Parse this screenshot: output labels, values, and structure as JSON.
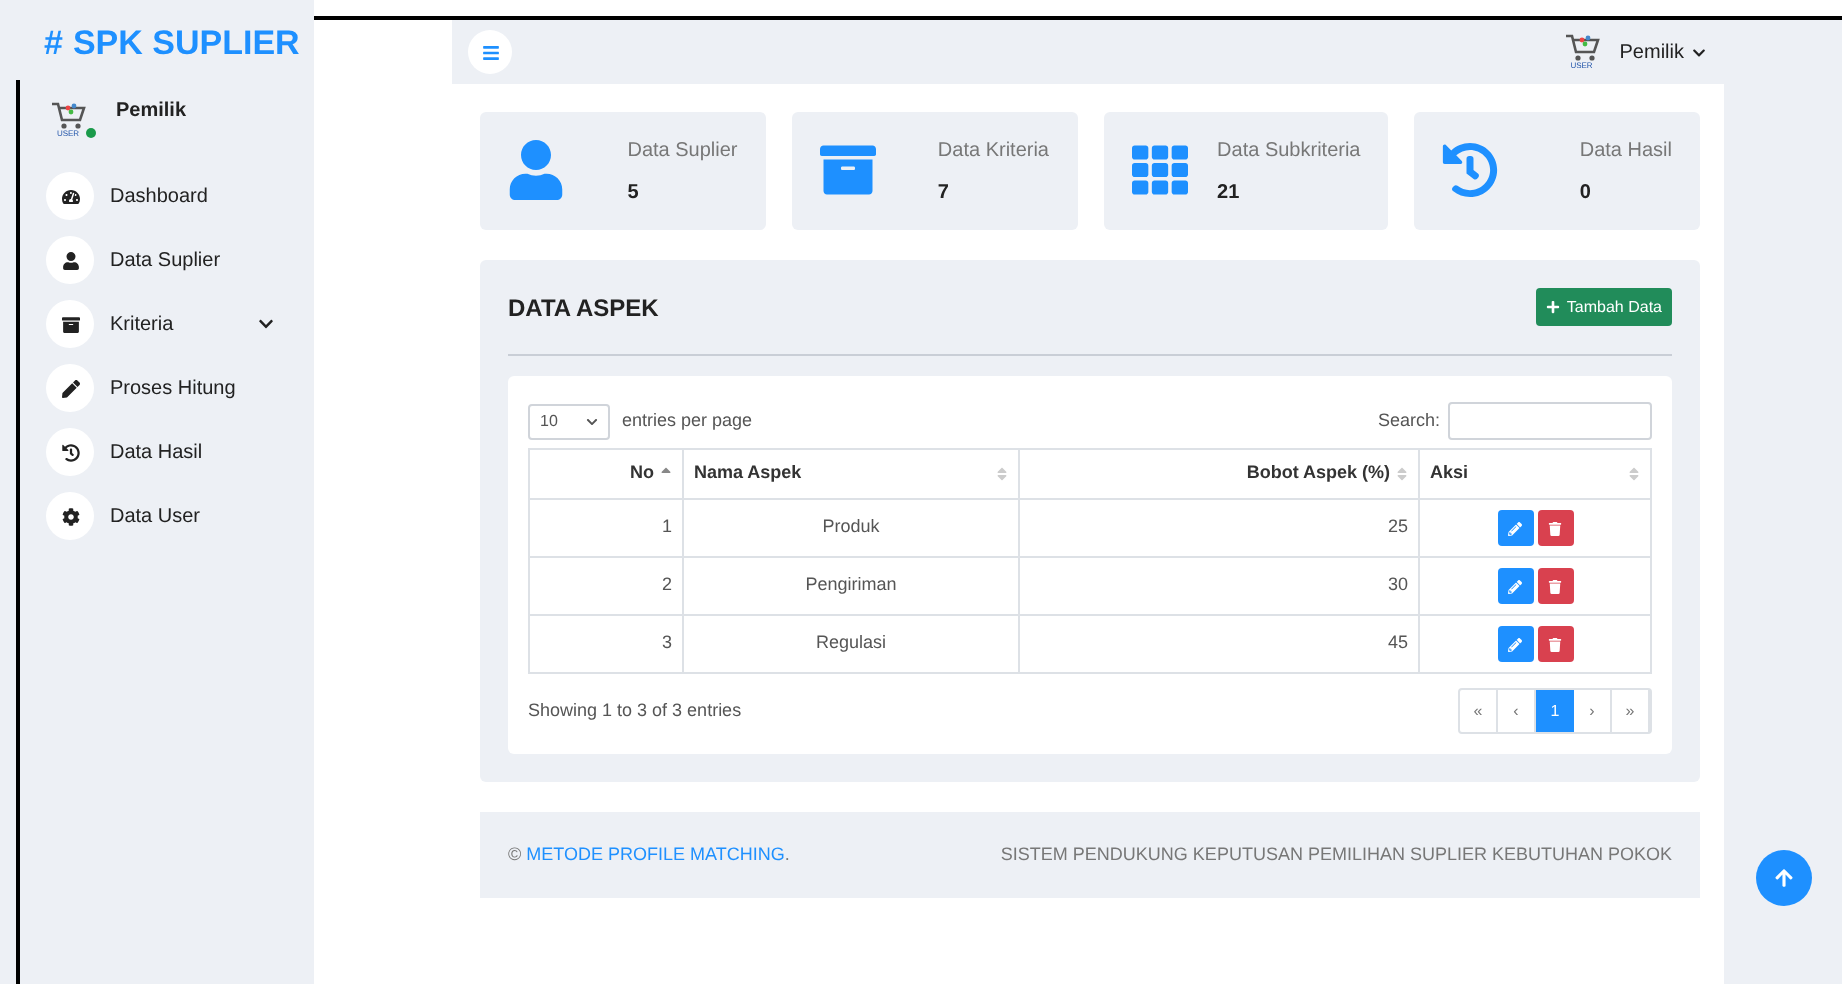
{
  "brand": {
    "mark": "#",
    "title": "SPK SUPLIER"
  },
  "sidebar": {
    "user": {
      "name": "Pemilik",
      "logo_text": "USER",
      "online": true
    },
    "items": [
      {
        "label": "Dashboard",
        "has_submenu": false
      },
      {
        "label": "Data Suplier",
        "has_submenu": false
      },
      {
        "label": "Kriteria",
        "has_submenu": true
      },
      {
        "label": "Proses Hitung",
        "has_submenu": false
      },
      {
        "label": "Data Hasil",
        "has_submenu": false
      },
      {
        "label": "Data User",
        "has_submenu": false
      }
    ]
  },
  "topbar": {
    "user_name": "Pemilik",
    "logo_text": "USER"
  },
  "stats": [
    {
      "label": "Data Suplier",
      "value": "5"
    },
    {
      "label": "Data Kriteria",
      "value": "7"
    },
    {
      "label": "Data Subkriteria",
      "value": "21"
    },
    {
      "label": "Data Hasil",
      "value": "0"
    }
  ],
  "panel": {
    "title": "DATA ASPEK",
    "add_button": "Tambah Data",
    "table": {
      "page_size": "10",
      "page_size_label": "entries per page",
      "search_label": "Search:",
      "columns": [
        {
          "label": "No",
          "sorted": true
        },
        {
          "label": "Nama Aspek",
          "sorted": false
        },
        {
          "label": "Bobot Aspek (%)",
          "sorted": false
        },
        {
          "label": "Aksi",
          "sorted": false
        }
      ],
      "rows": [
        [
          "1",
          "Produk",
          "25"
        ],
        [
          "2",
          "Pengiriman",
          "30"
        ],
        [
          "3",
          "Regulasi",
          "45"
        ]
      ],
      "info": "Showing 1 to 3 of 3 entries",
      "pagination": [
        {
          "label": "«",
          "selected": false
        },
        {
          "label": "‹",
          "selected": false
        },
        {
          "label": "1",
          "selected": true
        },
        {
          "label": "›",
          "selected": false
        },
        {
          "label": "»",
          "selected": false
        }
      ]
    }
  },
  "footer": {
    "prefix": "©",
    "link": "METODE PROFILE MATCHING",
    "suffix": ".",
    "right": "SISTEM PENDUKUNG KEPUTUSAN PEMILIHAN SUPLIER KEBUTUHAN POKOK"
  }
}
